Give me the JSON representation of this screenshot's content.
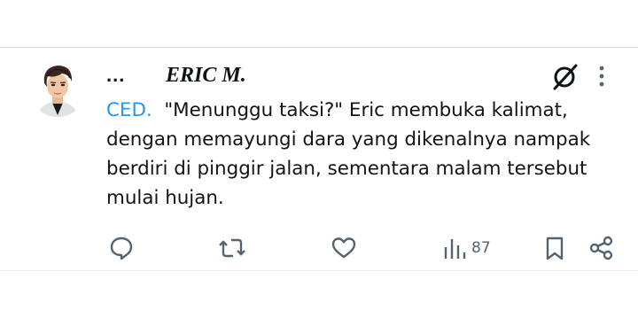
{
  "post": {
    "header": {
      "handle_ellipsis": "...",
      "display_name": "ERIC M."
    },
    "text": {
      "mention": "CED.",
      "body": "  \"Menunggu taksi?\" Eric membuka kalimat,\ndengan memayungi dara yang dikenalnya nampak\nberdiri di pinggir jalan, sementara malam tersebut\nmulai hujan."
    },
    "actions": {
      "views": "87"
    },
    "icons": [
      "avatar",
      "grok-icon",
      "more-icon",
      "reply-icon",
      "repost-icon",
      "like-icon",
      "views-icon",
      "bookmark-icon",
      "share-icon"
    ],
    "colors": {
      "text": "#0f1419",
      "mention": "#1d9bf0",
      "icon": "#536471"
    }
  }
}
